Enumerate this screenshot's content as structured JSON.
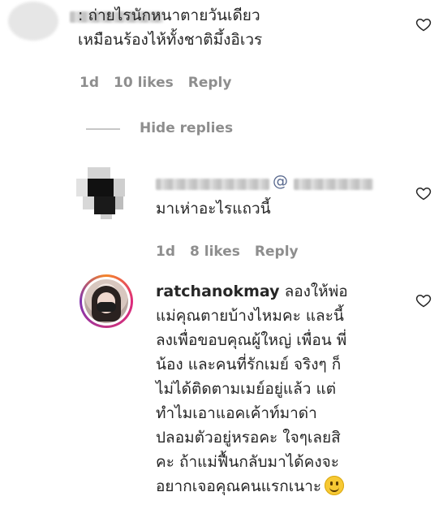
{
  "comments": [
    {
      "username": "",
      "text": ": ถ่ายไรนักหนาตายวันเดียว\nเหมือนร้องไห้ทั้งชาติมึ้งอิเวร",
      "meta": {
        "time": "1d",
        "likes": "10 likes",
        "reply": "Reply"
      }
    }
  ],
  "replies_toggle": {
    "label": "Hide replies"
  },
  "replies": [
    {
      "username": "",
      "mention": "@",
      "text": "มาเห่าอะไรแถวนี้",
      "meta": {
        "time": "1d",
        "likes": "8 likes",
        "reply": "Reply"
      }
    },
    {
      "username": "ratchanokmay",
      "text_lines": [
        "ลองให้พ่อ",
        "แม่คุณตายบ้างไหมคะ และนี้",
        "ลงเพื่อขอบคุณผู้ใหญ่ เพื่อน พี่",
        "น้อง และคนที่รักเมย์ จริงๆ ก็",
        "ไม่ได้ติดตามเมย์อยู่แล้ว แต่",
        "ทำไมเอาแอคเค้าท์มาด่า",
        "ปลอมตัวอยู่หรอคะ ใจๆเลยสิ",
        "คะ ถ้าแม่ฟื้นกลับมาได้คงจะ",
        "อยากเจอคุณคนแรกเนาะ"
      ]
    }
  ],
  "colors": {
    "text": "#262626",
    "muted": "#8e8e8e",
    "heart_outline": "#262626"
  },
  "icons": {
    "like": "heart-outline-icon",
    "emoji": "slightly-smiling-face-emoji"
  }
}
